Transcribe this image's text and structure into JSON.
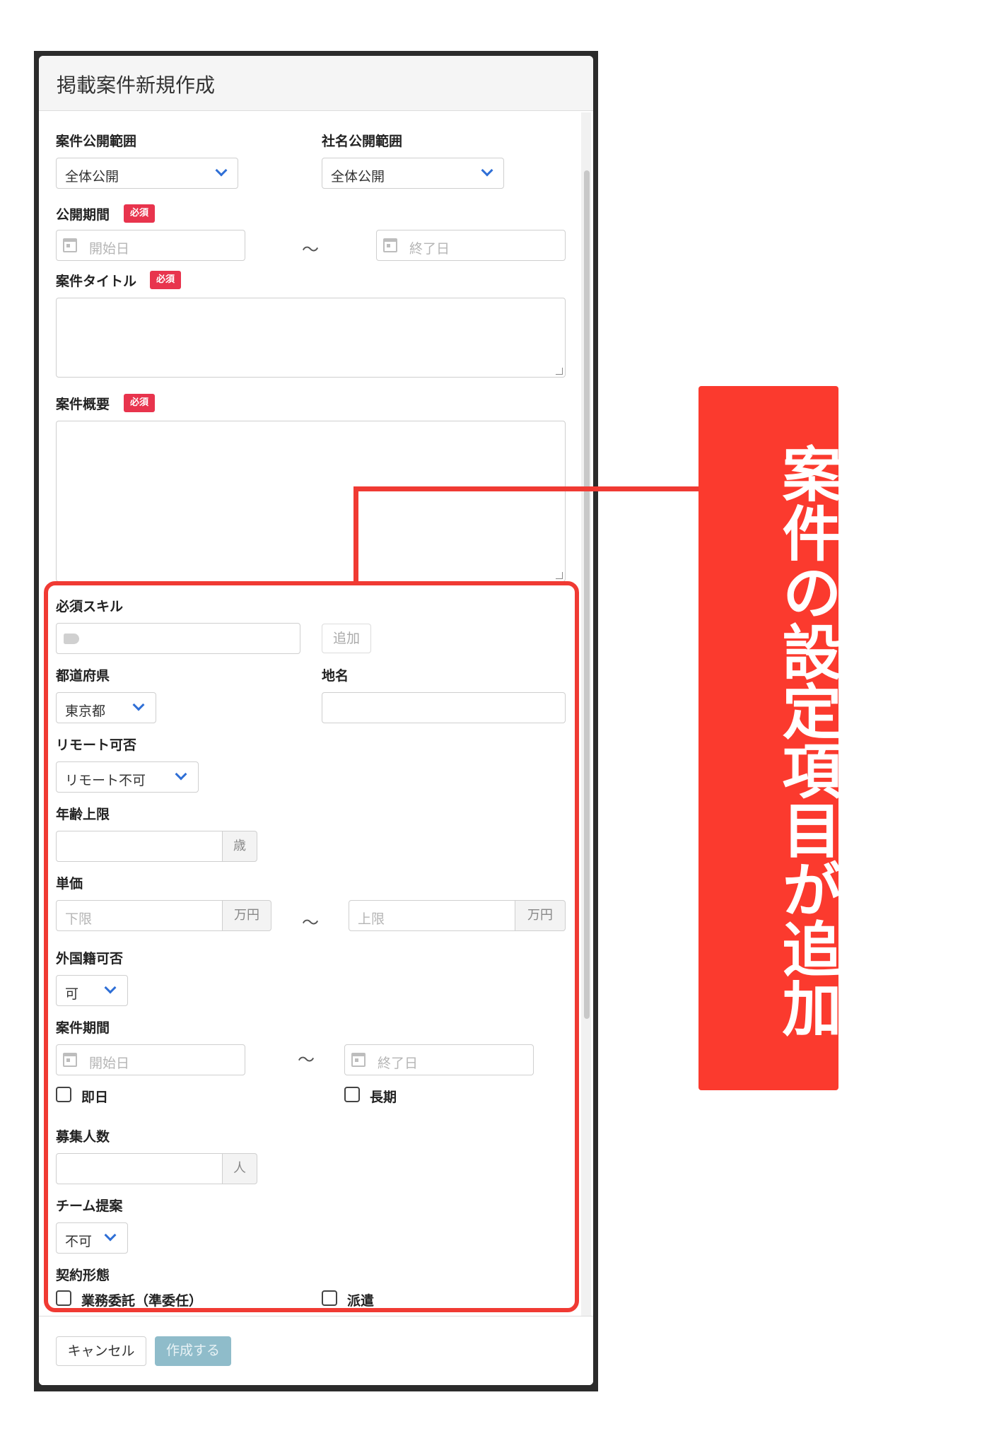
{
  "modal": {
    "title": "掲載案件新規作成"
  },
  "form": {
    "case_visibility": {
      "label": "案件公開範囲",
      "value": "全体公開"
    },
    "company_visibility": {
      "label": "社名公開範囲",
      "value": "全体公開"
    },
    "publish_period": {
      "label": "公開期間",
      "required": "必須",
      "start_placeholder": "開始日",
      "end_placeholder": "終了日",
      "separator": "〜"
    },
    "case_title": {
      "label": "案件タイトル",
      "required": "必須"
    },
    "case_summary": {
      "label": "案件概要",
      "required": "必須"
    },
    "required_skills": {
      "label": "必須スキル",
      "add_button": "追加"
    },
    "prefecture": {
      "label": "都道府県",
      "value": "東京都"
    },
    "place_name": {
      "label": "地名"
    },
    "remote": {
      "label": "リモート可否",
      "value": "リモート不可"
    },
    "age_limit": {
      "label": "年齢上限",
      "unit": "歳"
    },
    "unit_price": {
      "label": "単価",
      "min_placeholder": "下限",
      "max_placeholder": "上限",
      "unit": "万円",
      "separator": "〜"
    },
    "foreign_nationality": {
      "label": "外国籍可否",
      "value": "可"
    },
    "case_period": {
      "label": "案件期間",
      "start_placeholder": "開始日",
      "end_placeholder": "終了日",
      "separator": "〜",
      "immediate": "即日",
      "long_term": "長期"
    },
    "recruit_count": {
      "label": "募集人数",
      "unit": "人"
    },
    "team_proposal": {
      "label": "チーム提案",
      "value": "不可"
    },
    "contract_type": {
      "label": "契約形態",
      "option_outsourcing": "業務委託（準委任）",
      "option_dispatch": "派遣"
    }
  },
  "footer": {
    "cancel_label": "キャンセル",
    "create_label": "作成する"
  },
  "annotation": {
    "callout_text": "案件の設定項目が追加"
  },
  "colors": {
    "highlight": "#f03a33",
    "required_badge": "#e8344d",
    "create_button": "#8fbcca",
    "chevron": "#2f6fd6"
  }
}
